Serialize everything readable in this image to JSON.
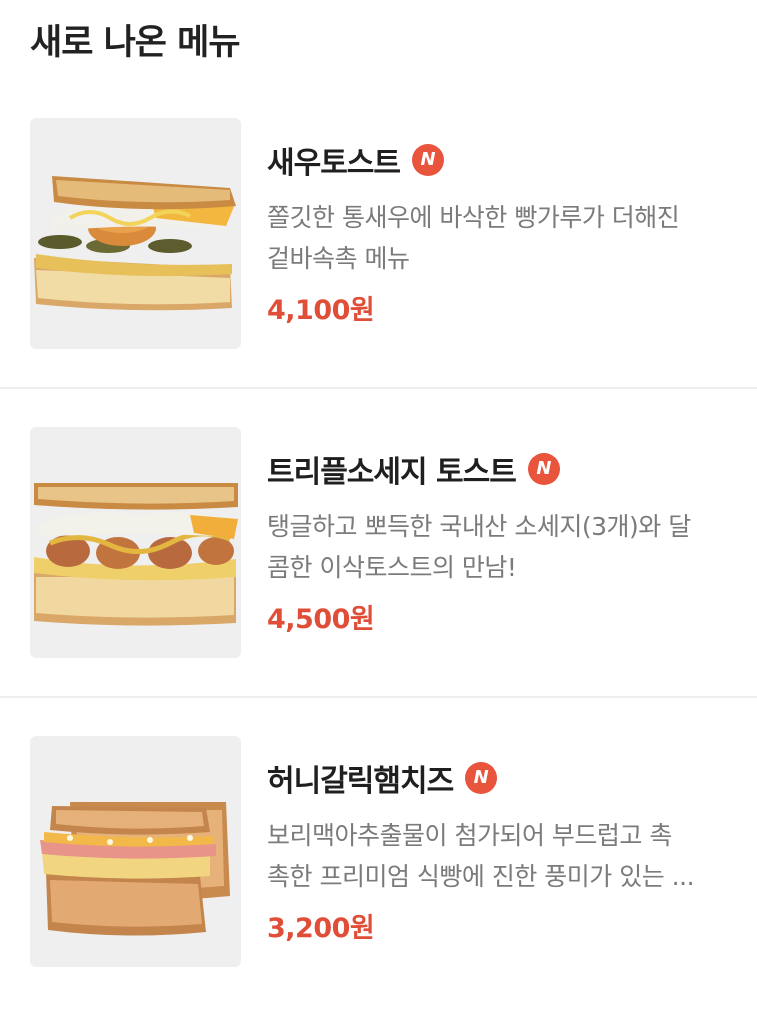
{
  "header": {
    "title": "새로 나온 메뉴"
  },
  "colors": {
    "accent": "#e04e38",
    "badge": "#e8543c",
    "thumb_bg": "#efeff0"
  },
  "menu": [
    {
      "name": "새우토스트",
      "badge": "N",
      "description": "쫄깃한 통새우에 바삭한 빵가루가 더해진\n겉바속촉 메뉴",
      "price": "4,100원",
      "image_icon": "shrimp-toast-image"
    },
    {
      "name": "트리플소세지 토스트",
      "badge": "N",
      "description": "탱글하고 뽀득한 국내산 소세지(3개)와 달\n콤한 이삭토스트의 만남!",
      "price": "4,500원",
      "image_icon": "triple-sausage-toast-image"
    },
    {
      "name": "허니갈릭햄치즈",
      "badge": "N",
      "description": "보리맥아추출물이 첨가되어 부드럽고 촉\n촉한 프리미엄 식빵에 진한 풍미가 있는 ...",
      "price": "3,200원",
      "image_icon": "honey-garlic-ham-cheese-image"
    }
  ]
}
